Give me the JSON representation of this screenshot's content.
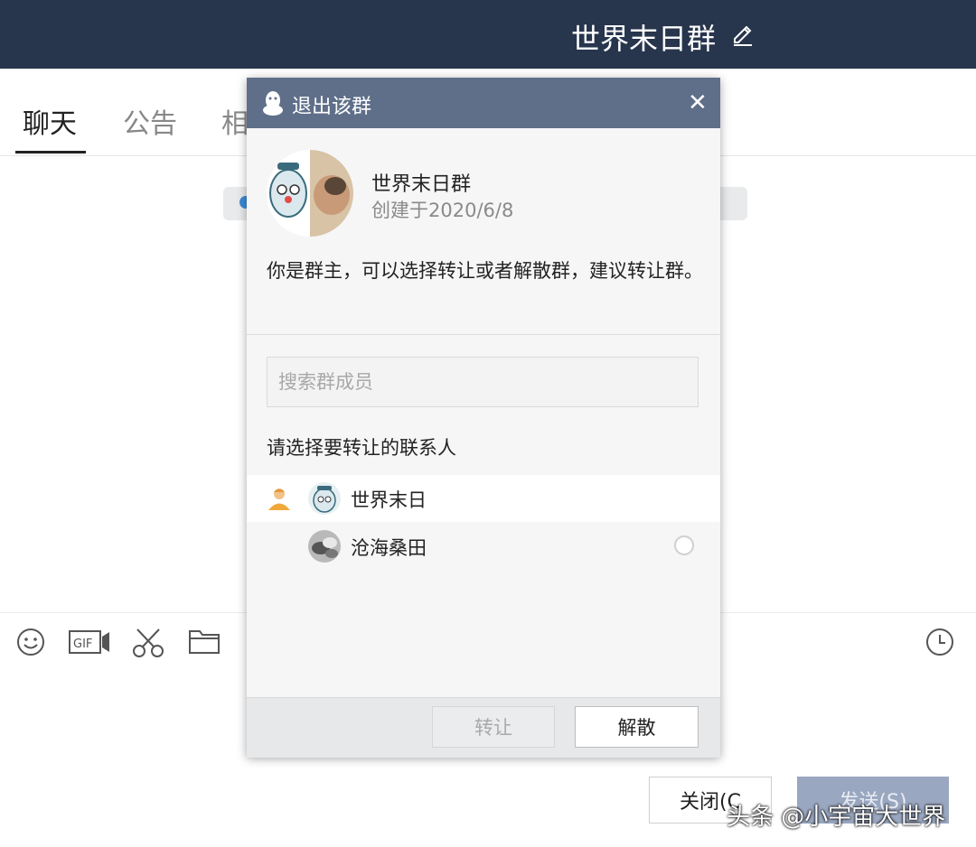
{
  "window": {
    "title": "世界末日群",
    "tabs": [
      "聊天",
      "公告",
      "相"
    ],
    "toolbar_icons": [
      "smile-icon",
      "gif-icon",
      "scissors-icon",
      "folder-icon",
      "clock-icon"
    ]
  },
  "footer": {
    "close_label": "关闭(C",
    "send_label": "发送(S)"
  },
  "watermark": "头条 @小宇宙大世界",
  "dialog": {
    "title": "退出该群",
    "close_symbol": "✕",
    "group_name": "世界末日群",
    "group_created": "创建于2020/6/8",
    "description": "你是群主，可以选择转让或者解散群，建议转让群。",
    "search_placeholder": "搜索群成员",
    "choose_label": "请选择要转让的联系人",
    "members": [
      {
        "name": "世界末日",
        "role": "owner"
      },
      {
        "name": "沧海桑田",
        "role": "member"
      }
    ],
    "transfer_label": "转让",
    "dissolve_label": "解散"
  },
  "colors": {
    "titlebar": "#27354d",
    "dialog_header": "#5f6f8a",
    "send_button": "#9aa7c0"
  }
}
